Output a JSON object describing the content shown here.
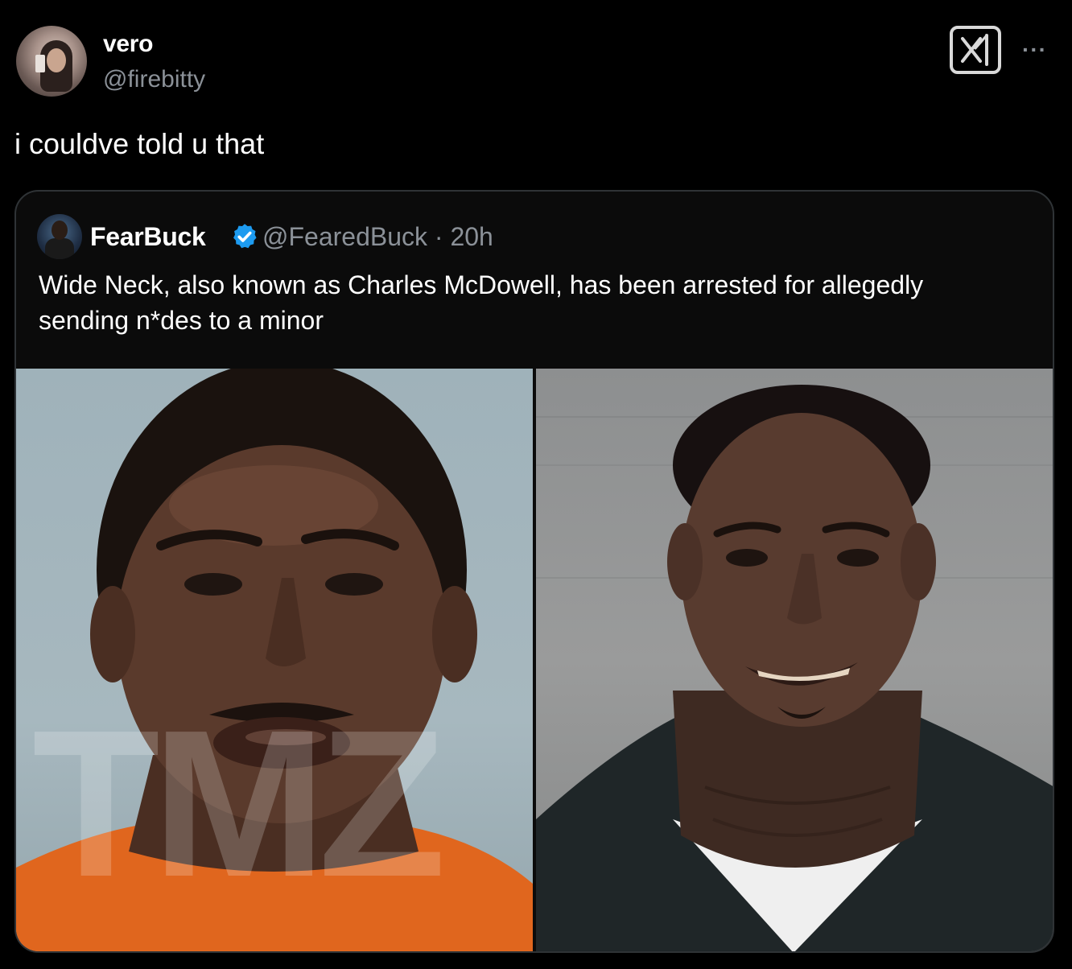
{
  "tweet": {
    "display_name": "vero",
    "handle": "@firebitty",
    "text": "i couldve told u that",
    "more_label": "···"
  },
  "quoted_tweet": {
    "display_name": "FearBuck",
    "verified": true,
    "handle_time": "@FearedBuck · 20h",
    "text": "Wide Neck, also known as Charles McDowell, has been arrested for allegedly sending n*des to a minor",
    "images": [
      {
        "watermark": "TMZ"
      },
      {
        "watermark": ""
      }
    ]
  },
  "colors": {
    "background": "#000000",
    "text_primary": "#ffffff",
    "text_secondary": "#8b9198",
    "border": "#2f3336",
    "verified": "#1d9bf0"
  },
  "icons": {
    "grok": "grok-icon",
    "more": "more-icon",
    "verified": "verified-badge-icon"
  }
}
